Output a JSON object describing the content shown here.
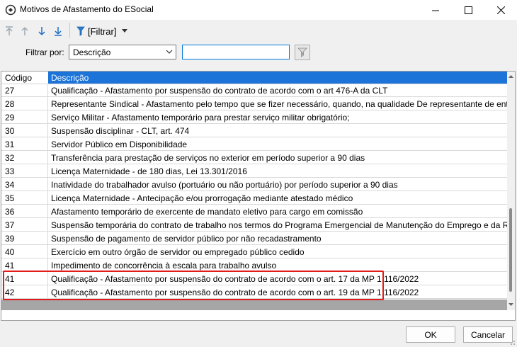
{
  "window": {
    "title": "Motivos de Afastamento do ESocial",
    "minimize_glyph": "—",
    "maximize_glyph": "☐",
    "close_glyph": "✕"
  },
  "toolbar": {
    "filter_button_label": "[Filtrar]"
  },
  "filter": {
    "label": "Filtrar por:",
    "field_selected": "Descrição",
    "search_value": ""
  },
  "grid": {
    "columns": [
      "Código",
      "Descrição"
    ],
    "rows": [
      {
        "code": "27",
        "desc": "Qualificação - Afastamento por suspensão do contrato de acordo com o art 476-A da CLT"
      },
      {
        "code": "28",
        "desc": "Representante Sindical - Afastamento pelo tempo que se fizer necessário, quando, na qualidade De representante de entidade sindical..."
      },
      {
        "code": "29",
        "desc": "Serviço Militar - Afastamento temporário para prestar serviço militar obrigatório;"
      },
      {
        "code": "30",
        "desc": "Suspensão disciplinar - CLT, art. 474"
      },
      {
        "code": "31",
        "desc": "Servidor Público em Disponibilidade"
      },
      {
        "code": "32",
        "desc": "Transferência para prestação de serviços no exterior em período superior a 90 dias"
      },
      {
        "code": "33",
        "desc": "Licença Maternidade - de 180 dias, Lei 13.301/2016"
      },
      {
        "code": "34",
        "desc": "Inatividade do trabalhador avulso (portuário ou não portuário) por período superior a 90 dias"
      },
      {
        "code": "35",
        "desc": "Licença Maternidade - Antecipação e/ou prorrogação mediante atestado médico"
      },
      {
        "code": "36",
        "desc": "Afastamento temporário de exercente de mandato eletivo para cargo em comissão"
      },
      {
        "code": "37",
        "desc": "Suspensão temporária do contrato de trabalho nos termos do Programa Emergencial de Manutenção do Emprego e da Renda"
      },
      {
        "code": "39",
        "desc": "Suspensão de pagamento de servidor público por não recadastramento"
      },
      {
        "code": "40",
        "desc": "Exercício em outro órgão de servidor ou empregado público cedido"
      },
      {
        "code": "41",
        "desc": "Impedimento de concorrência à escala para trabalho avulso"
      },
      {
        "code": "41",
        "desc": "Qualificação - Afastamento por suspensão do contrato de acordo com o art. 17 da MP 1.116/2022"
      },
      {
        "code": "42",
        "desc": "Qualificação - Afastamento por suspensão do contrato de acordo com o art. 19 da MP 1.116/2022"
      }
    ]
  },
  "buttons": {
    "ok": "OK",
    "cancel": "Cancelar"
  },
  "colors": {
    "header_selected": "#1c74d9",
    "highlight_border": "#e21b1b"
  }
}
